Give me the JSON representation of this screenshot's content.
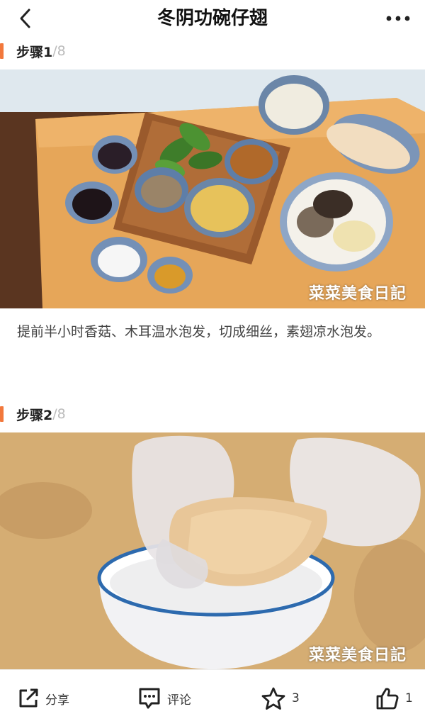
{
  "header": {
    "title": "冬阴功碗仔翅"
  },
  "steps": [
    {
      "label": "步骤1",
      "total": "/8",
      "watermark": "菜菜美食日記",
      "description": "提前半小时香菇、木耳温水泡发，切成细丝，素翅凉水泡发。"
    },
    {
      "label": "步骤2",
      "total": "/8",
      "watermark": "菜菜美食日記"
    }
  ],
  "bottom_bar": {
    "share_label": "分享",
    "comment_label": "评论",
    "star_count": "3",
    "like_count": "1"
  },
  "colors": {
    "accent": "#f2783c"
  }
}
